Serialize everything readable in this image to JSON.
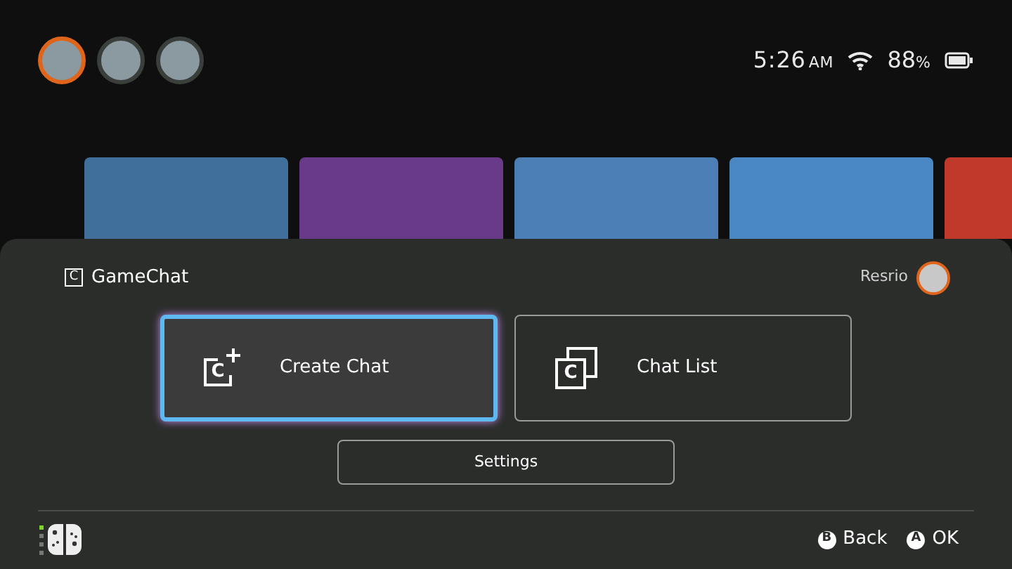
{
  "top_bar": {
    "users": [
      {
        "color": "#e0651a"
      },
      {
        "color": "#3a3f3b"
      },
      {
        "color": "#3a3f3b"
      }
    ],
    "time": "5:26",
    "meridiem": "AM",
    "battery": "88",
    "battery_unit": "%"
  },
  "panel": {
    "icon_letter": "C",
    "title": "GameChat",
    "user_name": "Resrio",
    "actions": [
      {
        "kind": "create",
        "icon_letter": "C",
        "label": "Create Chat",
        "selected": true
      },
      {
        "kind": "list",
        "icon_letter": "C",
        "label": "Chat List",
        "selected": false
      }
    ],
    "settings_button": "Settings"
  },
  "footer": {
    "hints": [
      {
        "key": "B",
        "label": "Back"
      },
      {
        "key": "A",
        "label": "OK"
      }
    ]
  }
}
